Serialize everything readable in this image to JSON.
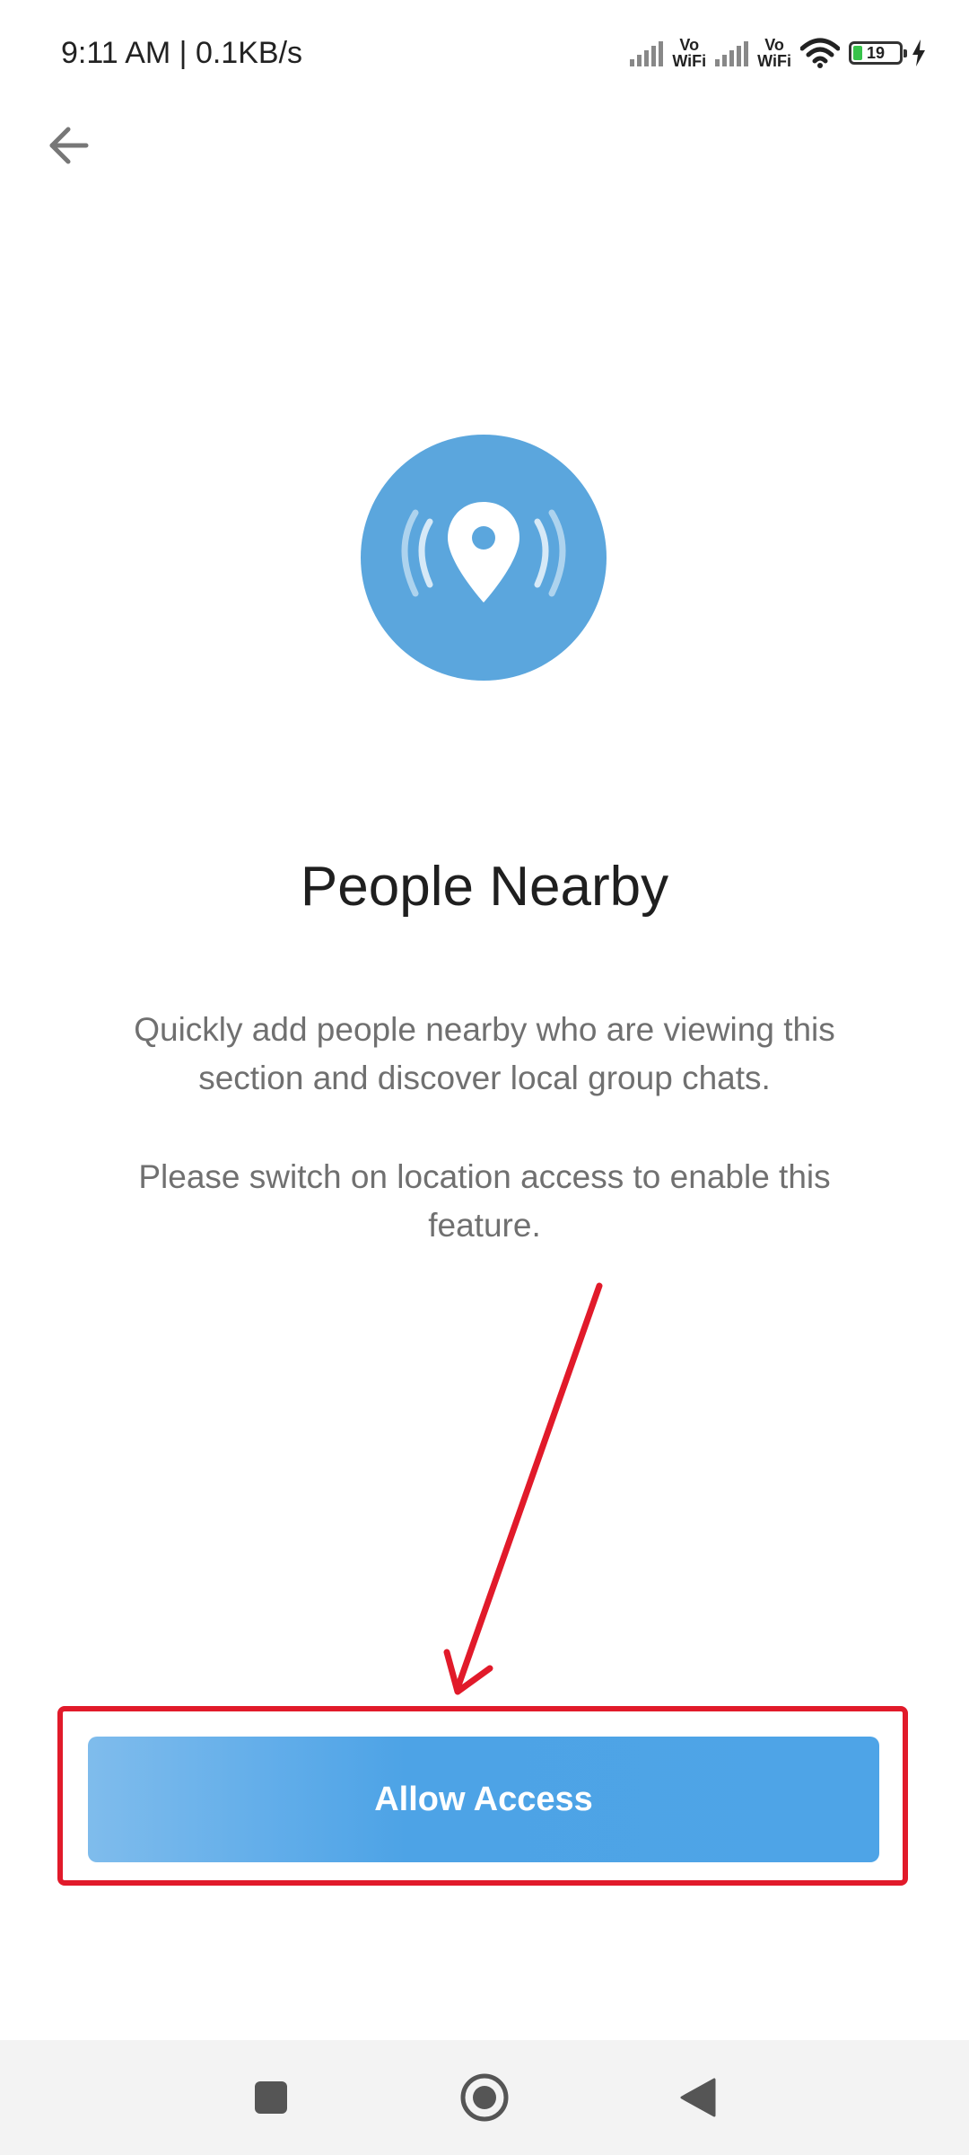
{
  "status_bar": {
    "time_text": "9:11 AM | 0.1KB/s",
    "vowifi_top": "Vo",
    "vowifi_bottom": "WiFi",
    "battery_level": "19",
    "battery_fraction": 0.19
  },
  "header": {
    "back_icon": "arrow-left-icon"
  },
  "hero": {
    "icon": "location-broadcast-icon",
    "circle_color": "#5ba6dd"
  },
  "content": {
    "title": "People Nearby",
    "description_1": "Quickly add people nearby who are viewing this section and discover local group chats.",
    "description_2": "Please switch on location access to enable this feature."
  },
  "action": {
    "allow_label": "Allow Access",
    "button_color": "#4ea4e7",
    "highlight_color": "#e11a2a"
  },
  "nav_bar": {
    "recent_icon": "square-icon",
    "home_icon": "circle-home-icon",
    "back_icon": "triangle-back-icon"
  }
}
